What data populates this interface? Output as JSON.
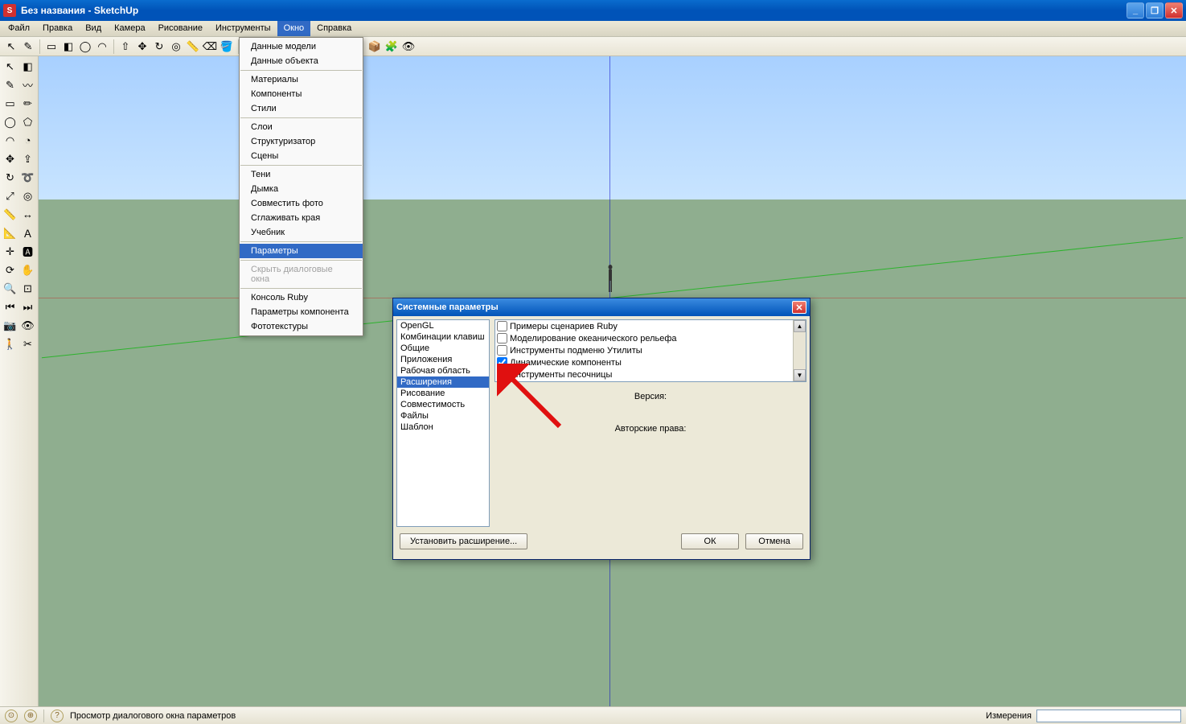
{
  "window": {
    "title": "Без названия - SketchUp"
  },
  "menubar": [
    "Файл",
    "Правка",
    "Вид",
    "Камера",
    "Рисование",
    "Инструменты",
    "Окно",
    "Справка"
  ],
  "dropdown": {
    "groups": [
      [
        "Данные модели",
        "Данные объекта"
      ],
      [
        "Материалы",
        "Компоненты",
        "Стили"
      ],
      [
        "Слои",
        "Структуризатор",
        "Сцены"
      ],
      [
        "Тени",
        "Дымка",
        "Совместить фото",
        "Сглаживать края",
        "Учебник"
      ],
      [
        "Параметры"
      ],
      [
        "Скрыть диалоговые окна"
      ],
      [
        "Консоль Ruby",
        "Параметры компонента",
        "Фототекстуры"
      ]
    ],
    "highlighted": "Параметры",
    "disabled": "Скрыть диалоговые окна"
  },
  "dialog": {
    "title": "Системные параметры",
    "categories": [
      "OpenGL",
      "Комбинации клавиш",
      "Общие",
      "Приложения",
      "Рабочая область",
      "Расширения",
      "Рисование",
      "Совместимость",
      "Файлы",
      "Шаблон"
    ],
    "selected_category": "Расширения",
    "extensions": [
      {
        "checked": false,
        "label": "Примеры сценариев Ruby"
      },
      {
        "checked": false,
        "label": "Моделирование океанического рельефа"
      },
      {
        "checked": false,
        "label": "Инструменты подменю Утилиты"
      },
      {
        "checked": true,
        "label": "Динамические компоненты"
      },
      {
        "checked": true,
        "label": "Инструменты песочницы"
      }
    ],
    "version_label": "Версия:",
    "copyright_label": "Авторские права:",
    "install_btn": "Установить расширение...",
    "ok_btn": "ОК",
    "cancel_btn": "Отмена"
  },
  "statusbar": {
    "hint": "Просмотр диалогового окна параметров",
    "measure_label": "Измерения"
  }
}
